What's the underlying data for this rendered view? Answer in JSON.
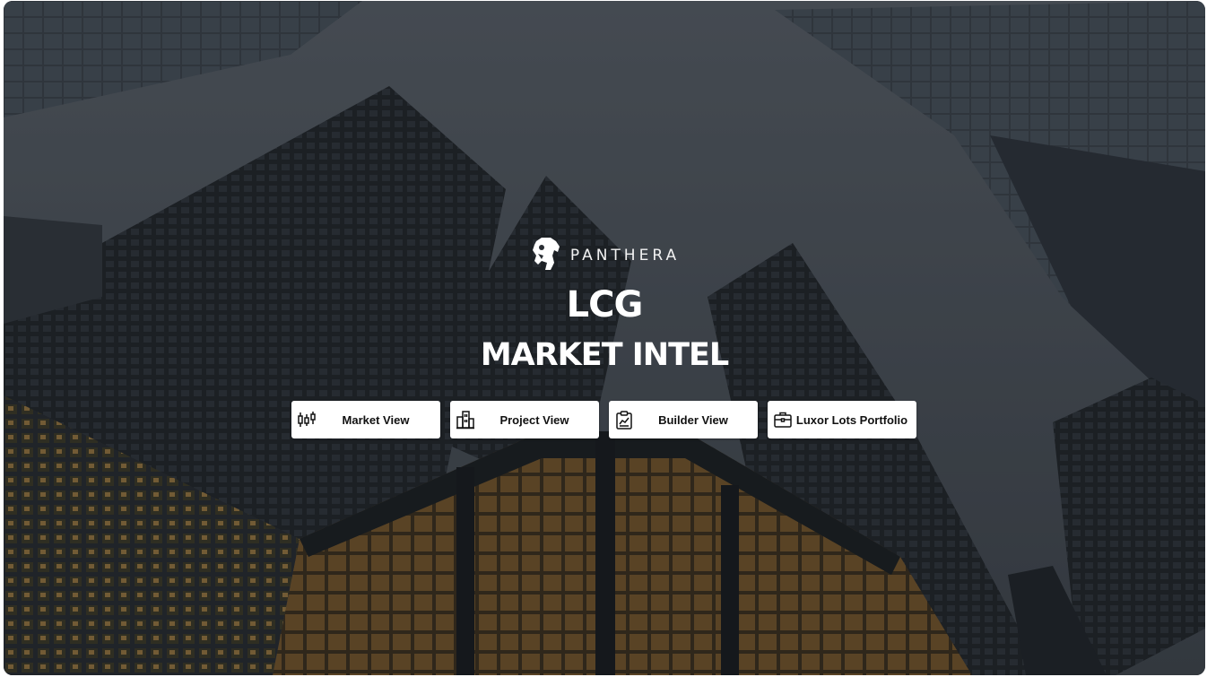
{
  "brand": {
    "logo_icon": "panther-head-icon",
    "name": "PANTHERA"
  },
  "hero": {
    "title": "LCG",
    "subtitle": "MARKET INTEL"
  },
  "nav_buttons": [
    {
      "label": "Market View",
      "icon": "candlestick-chart-icon"
    },
    {
      "label": "Project View",
      "icon": "buildings-icon"
    },
    {
      "label": "Builder View",
      "icon": "clipboard-chart-icon"
    },
    {
      "label": "Luxor Lots Portfolio",
      "icon": "briefcase-icon"
    }
  ],
  "colors": {
    "overlay": "#1e2228",
    "button_bg": "#ffffff",
    "text_light": "#ffffff",
    "text_dark": "#111111"
  }
}
